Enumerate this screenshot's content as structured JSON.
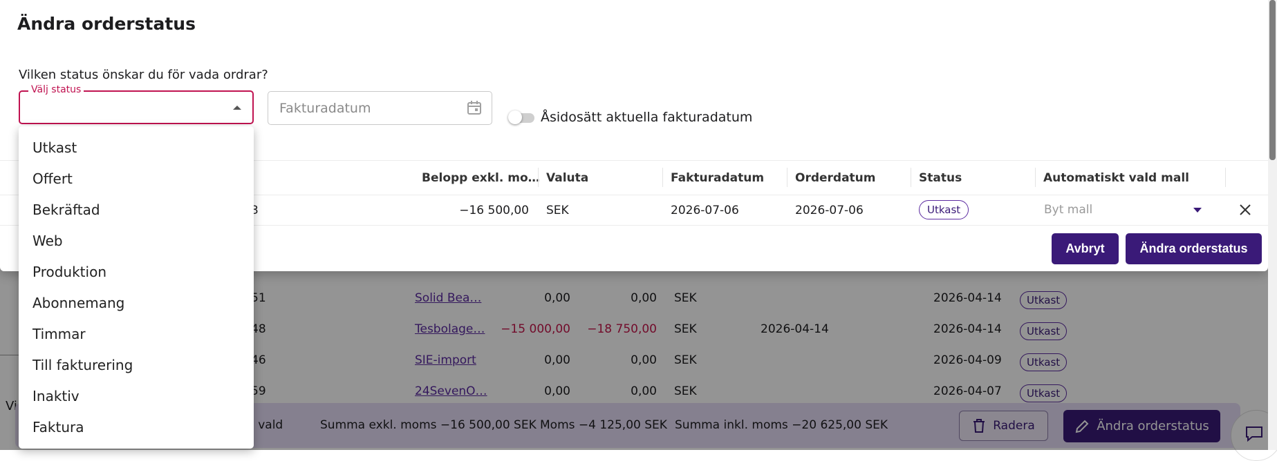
{
  "modal": {
    "title": "Ändra orderstatus",
    "question": "Vilken status önskar du för vada ordrar?",
    "status_select": {
      "legend": "Välj status",
      "value": ""
    },
    "date_input": {
      "placeholder": "Fakturadatum"
    },
    "toggle": {
      "label": "Åsidosätt aktuella fakturadatum",
      "checked": false
    },
    "table": {
      "headers": [
        "Belopp exkl. mo…",
        "Valuta",
        "Fakturadatum",
        "Orderdatum",
        "Status",
        "Automatiskt vald mall"
      ],
      "row": {
        "id_fragment": "3",
        "amount": "−16 500,00",
        "currency": "SEK",
        "invoice_date": "2026-07-06",
        "order_date": "2026-07-06",
        "status": "Utkast",
        "template_placeholder": "Byt mall"
      }
    },
    "buttons": {
      "cancel": "Avbryt",
      "confirm": "Ändra orderstatus"
    }
  },
  "dropdown": {
    "options": [
      "Utkast",
      "Offert",
      "Bekräftad",
      "Web",
      "Produktion",
      "Abonnemang",
      "Timmar",
      "Till fakturering",
      "Inaktiv",
      "Faktura"
    ]
  },
  "background": {
    "rows": [
      {
        "id": "51",
        "customer": "Solid Bea…",
        "amount": "0,00",
        "amount_incl": "0,00",
        "currency": "SEK",
        "invoice_date": "",
        "order_date": "2026-04-14",
        "status": "Utkast",
        "negative": false
      },
      {
        "id": "48",
        "customer": "Tesbolage…",
        "amount": "−15 000,00",
        "amount_incl": "−18 750,00",
        "currency": "SEK",
        "invoice_date": "2026-04-14",
        "order_date": "2026-04-14",
        "status": "Utkast",
        "negative": true
      },
      {
        "id": "46",
        "customer": "SIE-import",
        "amount": "0,00",
        "amount_incl": "0,00",
        "currency": "SEK",
        "invoice_date": "",
        "order_date": "2026-04-09",
        "status": "Utkast",
        "negative": false
      },
      {
        "id": "59",
        "customer": "24SevenO…",
        "amount": "0,00",
        "amount_incl": "0,00",
        "currency": "SEK",
        "invoice_date": "",
        "order_date": "2026-04-07",
        "status": "Utkast",
        "negative": false
      }
    ],
    "left_label": "Vi",
    "action_bar": {
      "selected": "1 vald",
      "sum_excl": "Summa exkl. moms −16 500,00 SEK",
      "vat": "Moms −4 125,00 SEK",
      "sum_incl": "Summa inkl. moms −20 625,00 SEK",
      "delete": "Radera",
      "change_status": "Ändra orderstatus"
    }
  },
  "colors": {
    "primary": "#3a1a78",
    "accent": "#c01250",
    "negative": "#c4154a"
  }
}
